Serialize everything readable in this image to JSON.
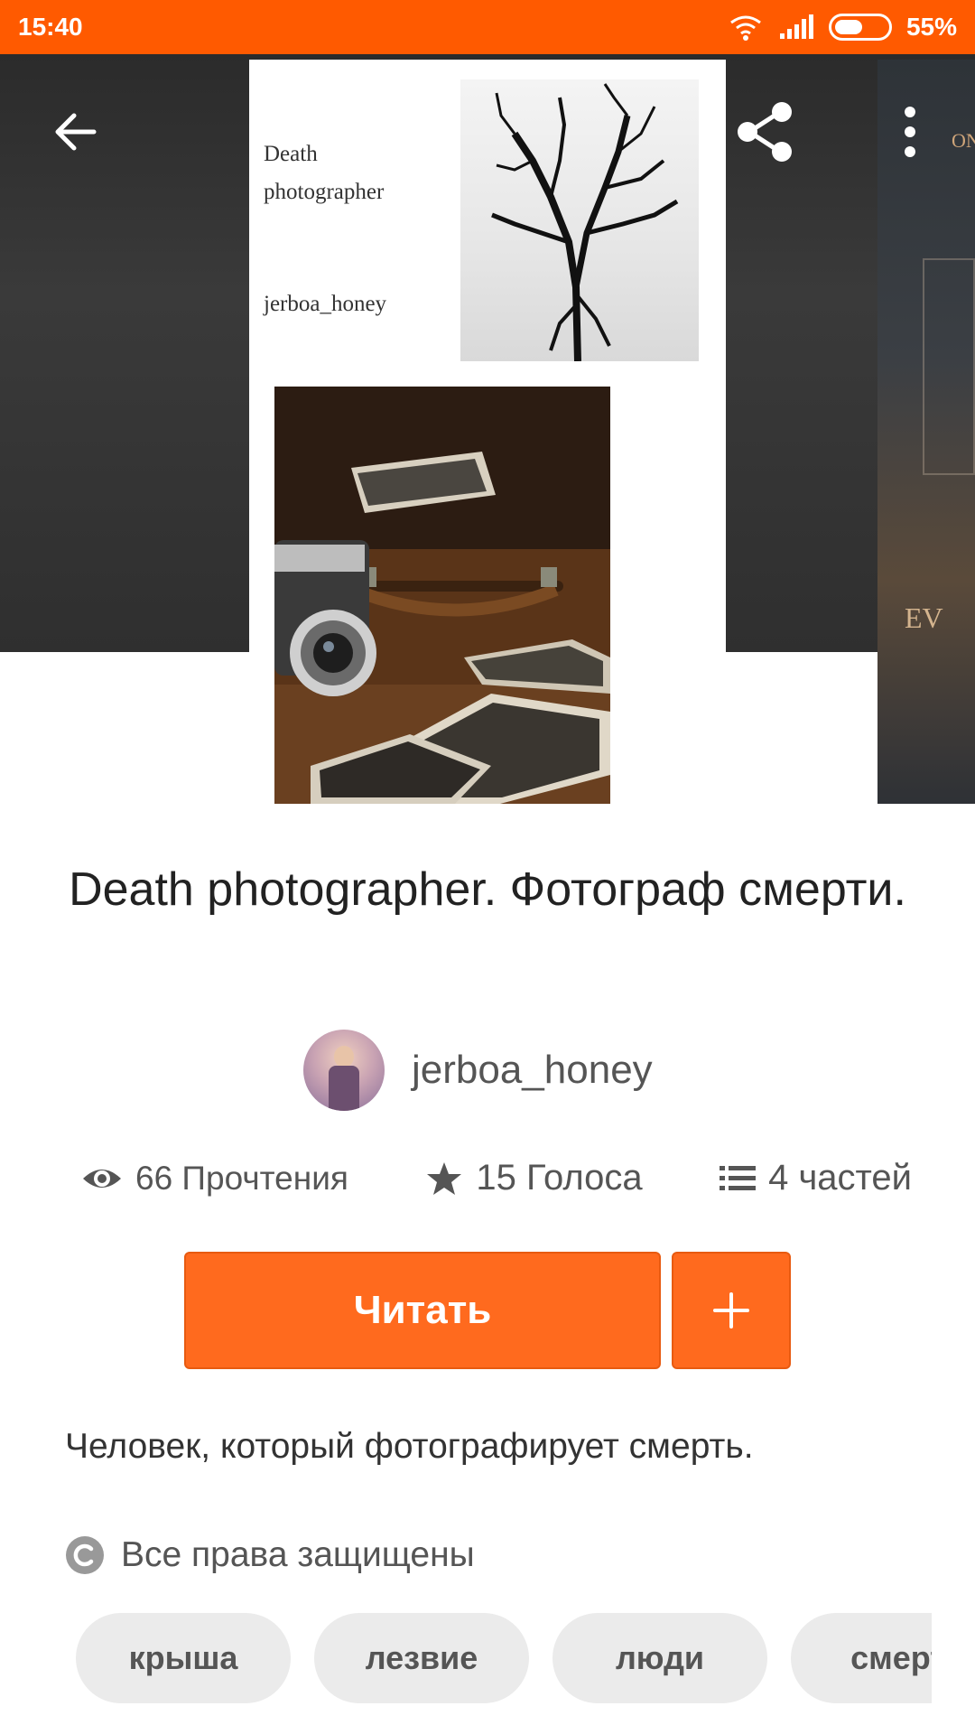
{
  "status_bar": {
    "time": "15:40",
    "battery_percent": "55%",
    "battery_level": 0.55,
    "icons": [
      "wifi-icon",
      "signal-icon",
      "battery-icon"
    ]
  },
  "header": {
    "back_icon": "arrow-left-icon",
    "share_icon": "share-icon",
    "more_icon": "more-vertical-icon"
  },
  "cover": {
    "title_line1": "Death",
    "title_line2": "photographer",
    "author": "jerboa_honey"
  },
  "next_cover": {
    "text_top": "ON",
    "text_mid": "EV"
  },
  "story": {
    "title": "Death photographer.  Фотограф смерти.",
    "author": "jerboa_honey",
    "stats": {
      "reads": "66 Прочтения",
      "votes": "15 Голоса",
      "parts": "4 частей"
    },
    "description": "Человек, который фотографирует смерть.",
    "copyright": "Все права защищены"
  },
  "actions": {
    "read_label": "Читать",
    "add_label": "+"
  },
  "tags": [
    "крыша",
    "лезвие",
    "люди",
    "смерт"
  ],
  "colors": {
    "accent": "#ff6a1e",
    "status_bar": "#ff5a00"
  }
}
